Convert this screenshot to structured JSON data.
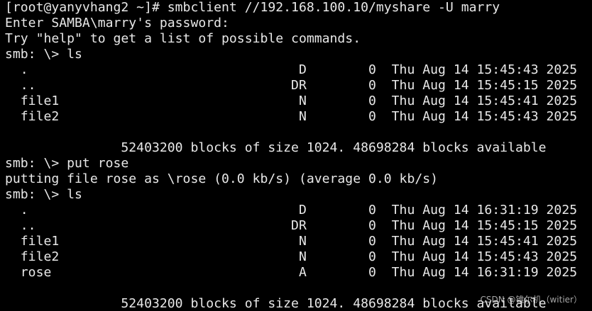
{
  "terminal": {
    "lines": [
      "[root@yanyvhang2 ~]# smbclient //192.168.100.10/myshare -U marry",
      "Enter SAMBA\\marry's password:",
      "Try \"help\" to get a list of possible commands.",
      "smb: \\> ls",
      "  .                                   D        0  Thu Aug 14 15:45:43 2025",
      "  ..                                 DR        0  Thu Aug 14 15:45:15 2025",
      "  file1                               N        0  Thu Aug 14 15:45:41 2025",
      "  file2                               N        0  Thu Aug 14 15:45:43 2025",
      "",
      "               52403200 blocks of size 1024. 48698284 blocks available",
      "smb: \\> put rose",
      "putting file rose as \\rose (0.0 kb/s) (average 0.0 kb/s)",
      "smb: \\> ls",
      "  .                                   D        0  Thu Aug 14 16:31:19 2025",
      "  ..                                 DR        0  Thu Aug 14 15:45:15 2025",
      "  file1                               N        0  Thu Aug 14 15:45:41 2025",
      "  file2                               N        0  Thu Aug 14 15:45:43 2025",
      "  rose                                A        0  Thu Aug 14 16:31:19 2025",
      "",
      "               52403200 blocks of size 1024. 48698284 blocks available"
    ]
  },
  "watermark": "CSDN @锥尔机（witier）",
  "colors": {
    "background": "#000000",
    "foreground": "#e8e8e8"
  }
}
